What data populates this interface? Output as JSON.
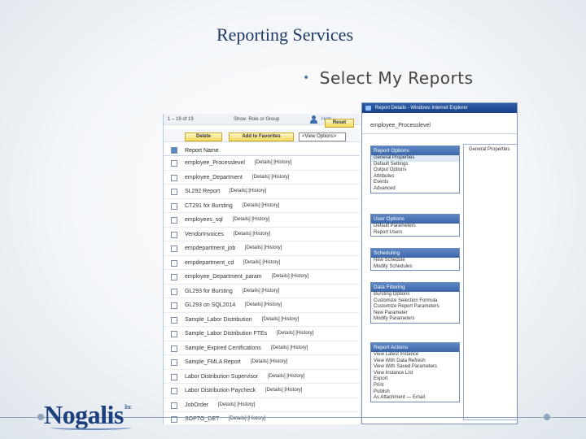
{
  "slide": {
    "title": "Reporting Services",
    "bullet": "Select My Reports"
  },
  "report_list": {
    "count_text": "1 – 19 of 19",
    "filter_text": "Show: Role or Group",
    "help_text": "Help",
    "reset_label": "Reset",
    "delete_label": "Delete",
    "favorites_label": "Add to Favorites",
    "view_select": "<View Options>",
    "column_header": "Report Name",
    "rows": [
      {
        "name": "employee_Processlevel",
        "links": "[Details] [History]"
      },
      {
        "name": "employee_Department",
        "links": "[Details] [History]"
      },
      {
        "name": "SL292 Report",
        "links": "[Details] [History]"
      },
      {
        "name": "CT291 for Bursting",
        "links": "[Details] [History]"
      },
      {
        "name": "employees_sql",
        "links": "[Details] [History]"
      },
      {
        "name": "VendorInvoices",
        "links": "[Details] [History]"
      },
      {
        "name": "empdepartment_job",
        "links": "[Details] [History]"
      },
      {
        "name": "empdepartment_cd",
        "links": "[Details] [History]"
      },
      {
        "name": "employee_Department_param",
        "links": "[Details] [History]"
      },
      {
        "name": "GL293 for Bursting",
        "links": "[Details] [History]"
      },
      {
        "name": "GL293 on SQL2014",
        "links": "[Details] [History]"
      },
      {
        "name": "Sample_Labor Distribution",
        "links": "[Details] [History]"
      },
      {
        "name": "Sample_Labor Distribution FTEs",
        "links": "[Details] [History]"
      },
      {
        "name": "Sample_Expired Certifications",
        "links": "[Details] [History]"
      },
      {
        "name": "Sample_FMLA Report",
        "links": "[Details] [History]"
      },
      {
        "name": "Labor Distribution Supervisor",
        "links": "[Details] [History]"
      },
      {
        "name": "Labor Distribution Paycheck",
        "links": "[Details] [History]"
      },
      {
        "name": "JobOrder",
        "links": "[Details] [History]"
      },
      {
        "name": "SOPTO_DET",
        "links": "[Details] [History]"
      }
    ]
  },
  "details_window": {
    "title": "Report Details - Windows Internet Explorer",
    "report_name": "employee_Processlevel",
    "side_tab": "General Properties",
    "sections": [
      {
        "title": "Report Options",
        "items": [
          "General Properties",
          "Default Settings",
          "Output Options",
          "Attributes",
          "Events",
          "Advanced"
        ],
        "selected": 0
      },
      {
        "title": "User Options",
        "items": [
          "Default Parameters",
          "Report Users"
        ]
      },
      {
        "title": "Scheduling",
        "items": [
          "New Schedule",
          "Modify Schedules"
        ]
      },
      {
        "title": "Data Filtering",
        "items": [
          "Bursting Options",
          "Customize Selection Formula",
          "Customize Report Parameters",
          "New Parameter",
          "Modify Parameters"
        ]
      },
      {
        "title": "Report Actions",
        "items": [
          "View Latest Instance",
          "View With Data Refresh",
          "View With Saved Parameters",
          "View Instance List",
          "Export",
          "Print",
          "Publish",
          "As Attachment — Email"
        ]
      }
    ]
  },
  "logo": {
    "name": "Nogalis",
    "suffix": "Inc"
  }
}
